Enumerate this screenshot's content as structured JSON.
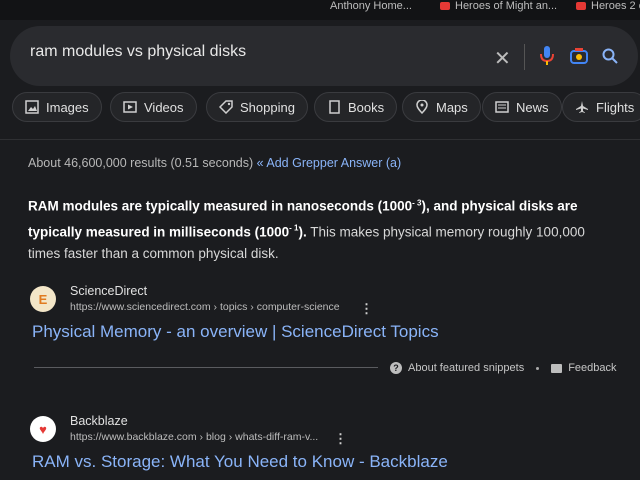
{
  "bookmarks": [
    {
      "label": "Anthony Home..."
    },
    {
      "label": "Heroes of Might an..."
    },
    {
      "label": "Heroes 2 o"
    }
  ],
  "search": {
    "query": "ram modules vs physical disks",
    "icons": [
      "close-icon",
      "mic-icon",
      "camera-icon",
      "search-icon"
    ]
  },
  "chips": [
    {
      "label": "Images",
      "icon": "image-icon"
    },
    {
      "label": "Videos",
      "icon": "video-icon"
    },
    {
      "label": "Shopping",
      "icon": "tag-icon"
    },
    {
      "label": "Books",
      "icon": "book-icon"
    },
    {
      "label": "Maps",
      "icon": "map-pin-icon"
    },
    {
      "label": "News",
      "icon": "news-icon"
    },
    {
      "label": "Flights",
      "icon": "plane-icon"
    }
  ],
  "results_stats": {
    "text": "About 46,600,000 results (0.51 seconds)",
    "grepper_link": "« Add Grepper Answer (a)"
  },
  "featured_snippet": {
    "part1": "RAM modules are typically measured in nanoseconds (1000",
    "sup1": "- 3",
    "part2": "), and physical disks are typically measured in milliseconds (1000",
    "sup2": "- 1",
    "part3": ").",
    "part4": " This makes physical memory roughly 100,000 times faster than a common physical disk."
  },
  "source1": {
    "favicon_letter": "E",
    "name": "ScienceDirect",
    "url": "https://www.sciencedirect.com › topics › computer-science",
    "title": "Physical Memory - an overview | ScienceDirect Topics"
  },
  "feedback_bar": {
    "about": "About featured snippets",
    "feedback": "Feedback"
  },
  "source2": {
    "favicon_letter": "♥",
    "name": "Backblaze",
    "url": "https://www.backblaze.com › blog › whats-diff-ram-v...",
    "title": "RAM vs. Storage: What You Need to Know - Backblaze"
  },
  "colors": {
    "background": "#1b1c1f",
    "link": "#8ab4f8",
    "text": "#d6d6d6"
  }
}
